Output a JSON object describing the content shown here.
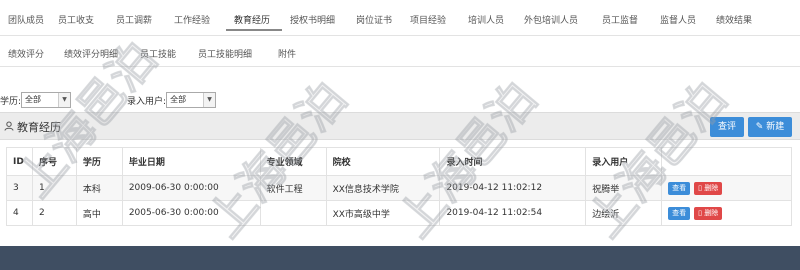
{
  "tabs_row1": [
    "团队成员",
    "员工收支",
    "员工调薪",
    "工作经验",
    "教育经历",
    "授权书明细",
    "岗位证书",
    "项目经验",
    "培训人员",
    "外包培训人员",
    "员工监督",
    "监督人员",
    "绩效结果"
  ],
  "tabs_row2": [
    "绩效评分",
    "绩效评分明细",
    "员工技能",
    "员工技能明细",
    "附件"
  ],
  "active_tab": "教育经历",
  "filters": {
    "education_label": "学历:",
    "education_value": "全部",
    "entry_user_label": "录入用户:",
    "entry_user_value": "全部"
  },
  "panel": {
    "title": "教育经历",
    "query_label": "查评",
    "new_label": "新建"
  },
  "table": {
    "columns": [
      "ID",
      "序号",
      "学历",
      "毕业日期",
      "专业领域",
      "院校",
      "录入时间",
      "录入用户",
      ""
    ],
    "rows": [
      {
        "id": "3",
        "seq": "1",
        "edu": "本科",
        "date": "2009-06-30 0:00:00",
        "major": "软件工程",
        "school": "XX信息技术学院",
        "entry_time": "2019-04-12 11:02:12",
        "user": "祝腾举"
      },
      {
        "id": "4",
        "seq": "2",
        "edu": "高中",
        "date": "2005-06-30 0:00:00",
        "major": "",
        "school": "XX市高级中学",
        "entry_time": "2019-04-12 11:02:54",
        "user": "边绘沂"
      }
    ],
    "view_label": "查看",
    "delete_label": "删除"
  },
  "watermark_text": "上海邑泊"
}
